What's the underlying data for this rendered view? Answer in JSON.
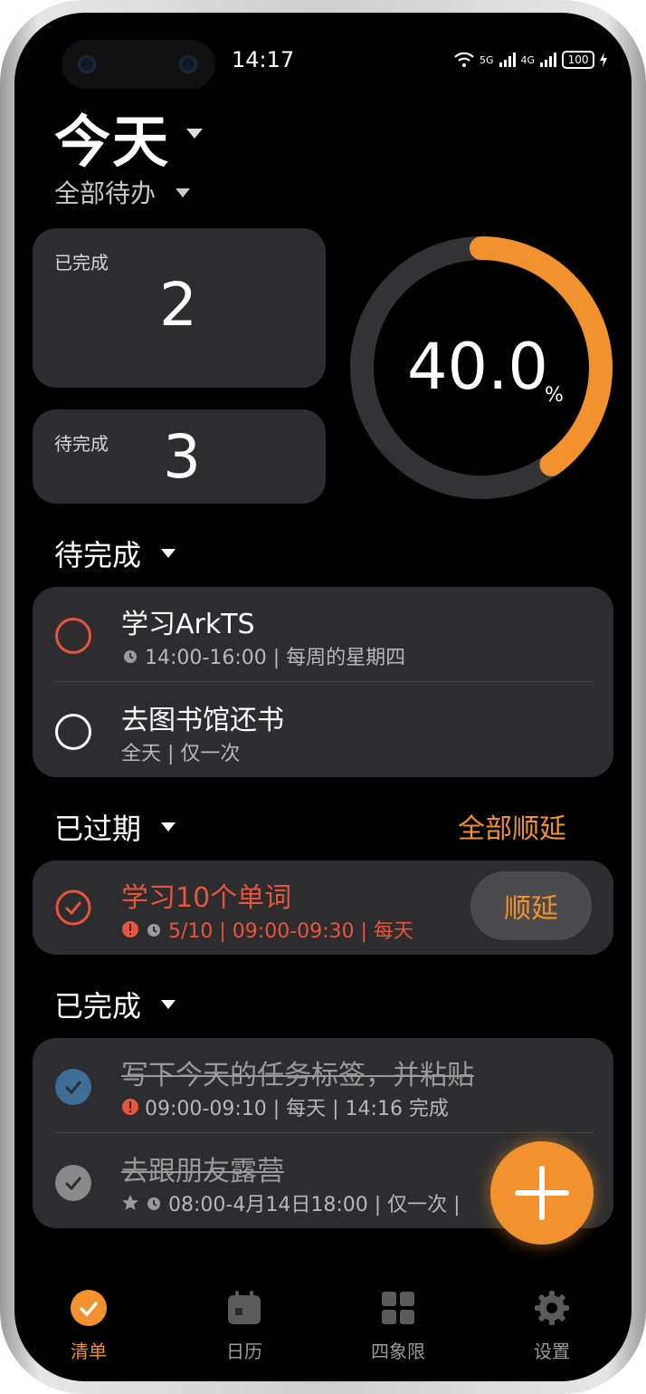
{
  "status_bar": {
    "time": "14:17",
    "net1": "5G",
    "net2": "4G",
    "battery": "100"
  },
  "header": {
    "title": "今天",
    "filter": "全部待办"
  },
  "stats": {
    "done_label": "已完成",
    "done_count": "2",
    "todo_label": "待完成",
    "todo_count": "3",
    "progress_value": "40.0",
    "progress_unit": "%",
    "progress_fraction": 0.4
  },
  "sections": {
    "pending": {
      "title": "待完成",
      "items": [
        {
          "title": "学习ArkTS",
          "meta": "14:00-16:00 | 每周的星期四"
        },
        {
          "title": "去图书馆还书",
          "meta": "全天 | 仅一次"
        }
      ]
    },
    "overdue": {
      "title": "已过期",
      "action": "全部顺延",
      "items": [
        {
          "title": "学习10个单词",
          "meta": "5/10 | 09:00-09:30 | 每天",
          "button": "顺延"
        }
      ]
    },
    "completed": {
      "title": "已完成",
      "items": [
        {
          "title": "写下今天的任务标签，并粘贴",
          "meta": "09:00-09:10 | 每天 | 14:16 完成"
        },
        {
          "title": "去跟朋友露营",
          "meta": "08:00-4月14日18:00 | 仅一次 |"
        }
      ]
    }
  },
  "tabs": [
    {
      "label": "清单",
      "icon": "check-circle-icon",
      "active": true
    },
    {
      "label": "日历",
      "icon": "calendar-icon",
      "active": false
    },
    {
      "label": "四象限",
      "icon": "grid-icon",
      "active": false
    },
    {
      "label": "设置",
      "icon": "gear-icon",
      "active": false
    }
  ],
  "colors": {
    "accent": "#f1922e",
    "overdue": "#e8553d",
    "card": "#2d2d2f",
    "done_blue": "#3e6e98"
  }
}
